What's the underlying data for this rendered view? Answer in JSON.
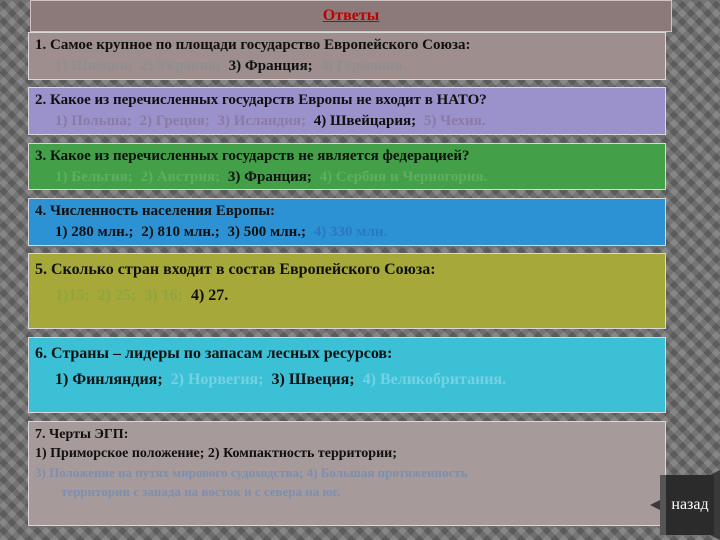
{
  "title": "Ответы",
  "q1": {
    "question": "1. Самое крупное по площади государство Европейского Союза:",
    "options": [
      "1) Швеция;",
      "2) Украина;",
      "3) Франция;",
      "4) Германия."
    ]
  },
  "q2": {
    "question": "2. Какое из перечисленных государств Европы не входит в НАТО?",
    "options": [
      "1) Польша;",
      "2) Греция;",
      "3) Исландия;",
      "4) Швейцария;",
      "5) Чехия."
    ]
  },
  "q3": {
    "question": "3. Какое из перечисленных государств не является федерацией?",
    "options": [
      "1) Бельгия;",
      "2) Австрия;",
      "3) Франция;",
      "4) Сербия и Черногория."
    ]
  },
  "q4": {
    "question": "4. Численность населения Европы:",
    "options": [
      "1) 280 млн.;",
      "2) 810 млн.;",
      "3) 500 млн.;",
      "4) 330 млн."
    ]
  },
  "q5": {
    "question": "5. Сколько стран входит в состав Европейского Союза:",
    "options": [
      "1)15;",
      "2) 25;",
      "3) 16;",
      "4) 27."
    ]
  },
  "q6": {
    "question": "6. Страны – лидеры по запасам лесных ресурсов:",
    "options": [
      "1) Финляндия;",
      "2) Норвегия;",
      "3) Швеция;",
      "4) Великобритания."
    ]
  },
  "q7": {
    "question": "7. Черты ЭГП:",
    "line1": "1) Приморское положение; 2) Компактность территории;",
    "line2": "3) Положение на путях мирового судоходства; 4) Большая протяженность",
    "line3": "территории с запада на восток и с севера на юг."
  },
  "nav": {
    "back_label": "назад"
  }
}
